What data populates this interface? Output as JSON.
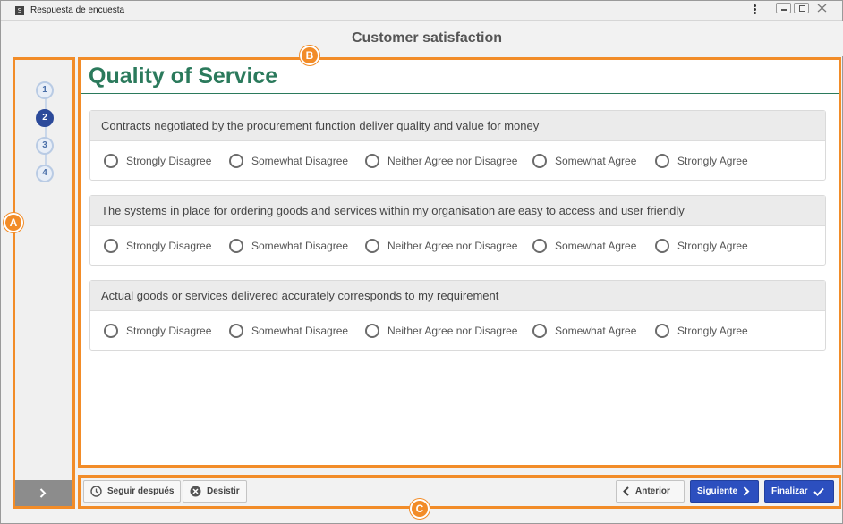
{
  "window": {
    "title": "Respuesta de encuesta",
    "app_icon_letter": "S"
  },
  "header": {
    "title": "Customer satisfaction"
  },
  "stepper": {
    "steps": [
      "1",
      "2",
      "3",
      "4"
    ],
    "active_step": "2"
  },
  "section": {
    "title": "Quality of Service"
  },
  "questions": [
    {
      "text": "Contracts negotiated by the procurement function deliver quality and value for money",
      "options": [
        "Strongly Disagree",
        "Somewhat Disagree",
        "Neither Agree nor Disagree",
        "Somewhat Agree",
        "Strongly Agree"
      ]
    },
    {
      "text": "The systems in place for ordering goods and services within my organisation are easy to access and user friendly",
      "options": [
        "Strongly Disagree",
        "Somewhat Disagree",
        "Neither Agree nor Disagree",
        "Somewhat Agree",
        "Strongly Agree"
      ]
    },
    {
      "text": "Actual goods or services delivered accurately corresponds to my requirement",
      "options": [
        "Strongly Disagree",
        "Somewhat Disagree",
        "Neither Agree nor Disagree",
        "Somewhat Agree",
        "Strongly Agree"
      ]
    }
  ],
  "footer": {
    "later_label": "Seguir después",
    "quit_label": "Desistir",
    "previous_label": "Anterior",
    "next_label": "Siguiente",
    "finish_label": "Finalizar"
  },
  "markers": {
    "a": "A",
    "b": "B",
    "c": "C"
  },
  "colors": {
    "accent_orange": "#f28c28",
    "section_green": "#2b7a5c",
    "primary_blue": "#2c4fbf"
  }
}
